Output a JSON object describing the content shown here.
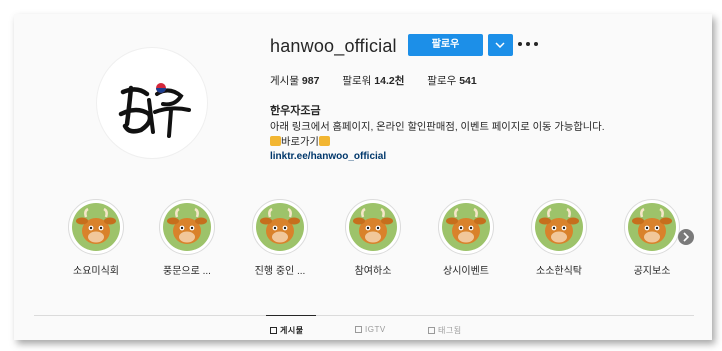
{
  "profile": {
    "username": "hanwoo_official",
    "follow_label": "팔로우",
    "stats": [
      {
        "label": "게시물",
        "value": "987"
      },
      {
        "label": "팔로워",
        "value": "14.2천"
      },
      {
        "label": "팔로우",
        "value": "541"
      }
    ],
    "bio_name": "한우자조금",
    "bio_text": "아래 링크에서 홈페이지, 온라인 할인판매점, 이벤트 페이지로 이동 가능합니다.",
    "bio_link_text": "바로가기",
    "url": "linktr.ee/hanwoo_official"
  },
  "highlights": [
    {
      "label": "소요미식회"
    },
    {
      "label": "풍문으로 ..."
    },
    {
      "label": "진행 중인 ..."
    },
    {
      "label": "참여하소"
    },
    {
      "label": "상시이벤트"
    },
    {
      "label": "소소한식탁"
    },
    {
      "label": "공지보소"
    }
  ],
  "tabs": [
    {
      "label": "게시물"
    },
    {
      "label": "IGTV"
    },
    {
      "label": "태그됨"
    }
  ],
  "colors": {
    "follow_button": "#1c8fe8",
    "highlight_bg": "#9dc36a",
    "link": "#00376b"
  }
}
